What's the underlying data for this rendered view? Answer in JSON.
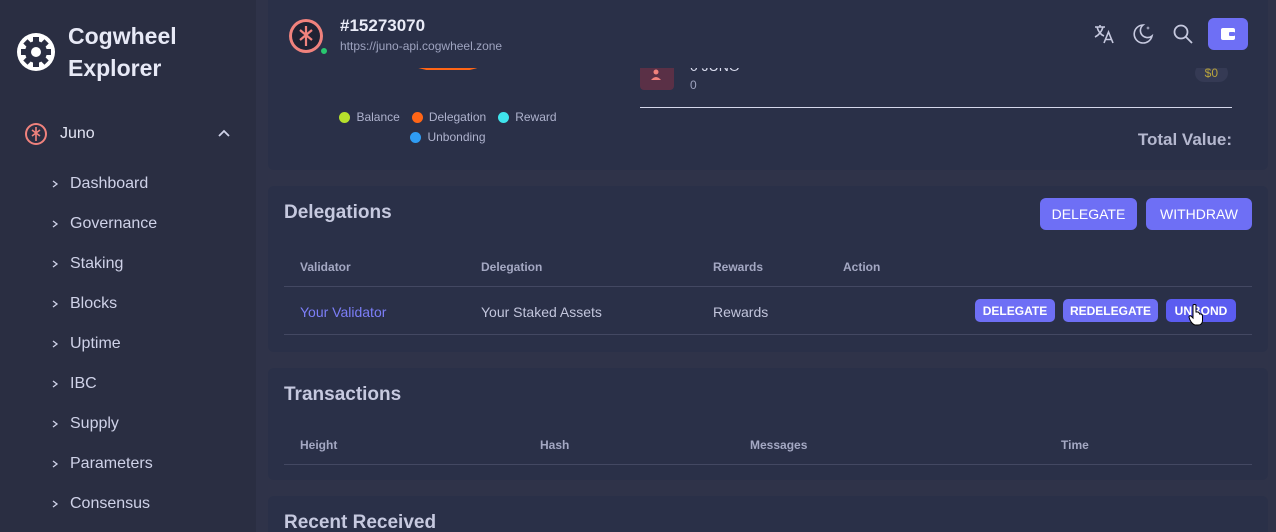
{
  "app": {
    "title": "Cogwheel Explorer"
  },
  "sidebar": {
    "chain": {
      "name": "Juno"
    },
    "items": [
      {
        "label": "Dashboard"
      },
      {
        "label": "Governance"
      },
      {
        "label": "Staking"
      },
      {
        "label": "Blocks"
      },
      {
        "label": "Uptime"
      },
      {
        "label": "IBC"
      },
      {
        "label": "Supply"
      },
      {
        "label": "Parameters"
      },
      {
        "label": "Consensus"
      }
    ]
  },
  "header": {
    "block": "#15273070",
    "endpoint": "https://juno-api.cogwheel.zone"
  },
  "overview": {
    "legend": [
      "Balance",
      "Delegation",
      "Reward",
      "Unbonding"
    ],
    "legend_colors": [
      "#b6e02c",
      "#ff6516",
      "#3fe4ec",
      "#2f9cf4"
    ],
    "asset": {
      "amount": "0 JUNO",
      "sub": "0",
      "value": "$0"
    },
    "total_label": "Total Value:"
  },
  "delegations": {
    "title": "Delegations",
    "delegate_btn": "DELEGATE",
    "withdraw_btn": "WITHDRAW",
    "columns": [
      "Validator",
      "Delegation",
      "Rewards",
      "Action"
    ],
    "row": {
      "validator": "Your Validator",
      "delegation": "Your Staked Assets",
      "rewards": "Rewards",
      "actions": [
        "DELEGATE",
        "REDELEGATE",
        "UNBOND"
      ]
    }
  },
  "transactions": {
    "title": "Transactions",
    "columns": [
      "Height",
      "Hash",
      "Messages",
      "Time"
    ]
  },
  "recent": {
    "title": "Recent Received"
  },
  "colors": {
    "accent": "#6e6ff5",
    "link": "#7c7ef8",
    "online": "#28c76f"
  }
}
